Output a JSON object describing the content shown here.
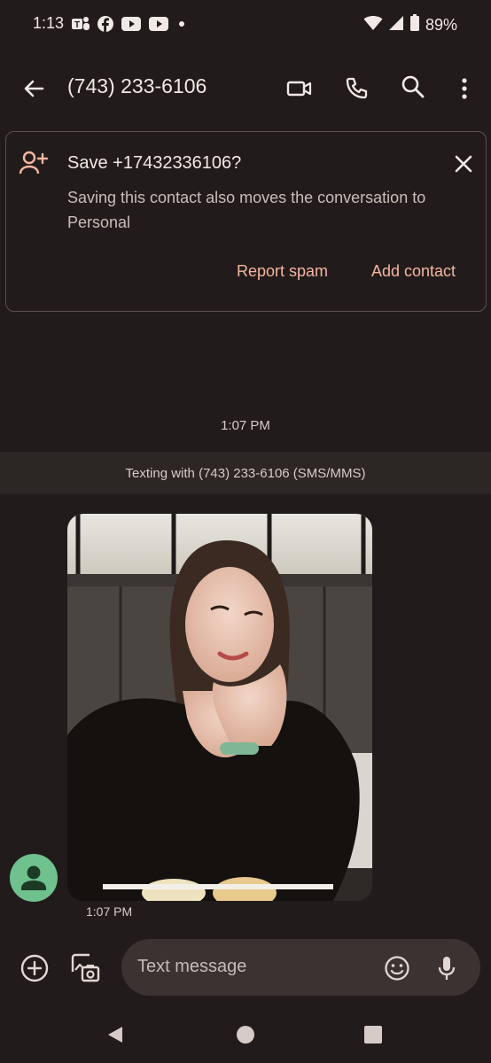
{
  "status_bar": {
    "time": "1:13",
    "notification_icons": [
      "teams-icon",
      "facebook-icon",
      "youtube-icon",
      "youtube-icon",
      "dot-icon"
    ],
    "battery": "89%"
  },
  "app_bar": {
    "title": "(743) 233-6106"
  },
  "save_card": {
    "title": "Save +17432336106?",
    "subtitle": "Saving this contact also moves the conversation to Personal",
    "report_spam_label": "Report spam",
    "add_contact_label": "Add contact"
  },
  "conversation": {
    "time_header": "1:07 PM",
    "texting_with": "Texting with (743) 233-6106 (SMS/MMS)",
    "message_time": "1:07 PM"
  },
  "compose": {
    "placeholder": "Text message"
  },
  "colors": {
    "background": "#211c1b",
    "accent": "#f6b59f",
    "avatar": "#6fc18d",
    "compose_field": "#3a3331"
  }
}
